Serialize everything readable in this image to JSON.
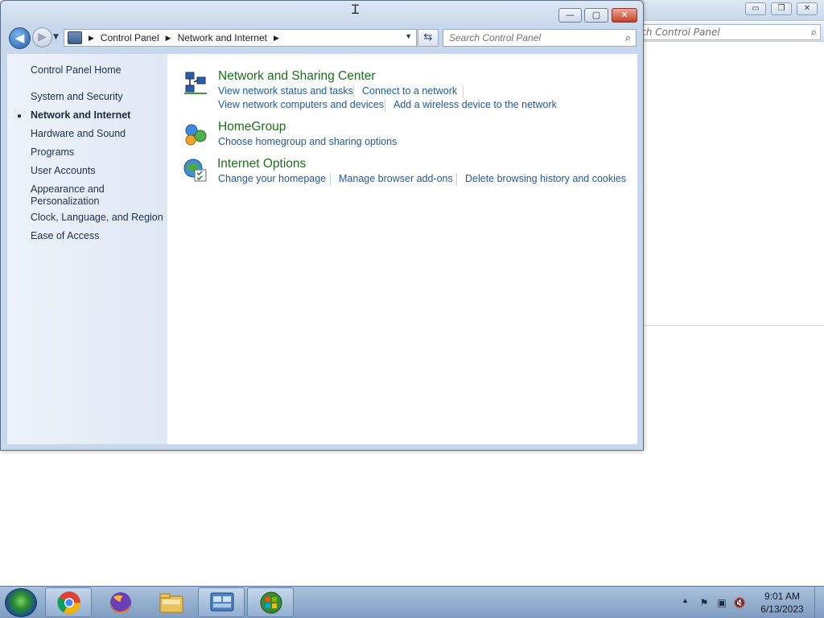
{
  "background_window": {
    "search_placeholder": "Search Control Panel",
    "controls": {
      "minimize": "▭",
      "restore": "❐",
      "close": "✕"
    }
  },
  "window": {
    "controls": {
      "minimize": "—",
      "maximize": "▢",
      "close": "✕"
    },
    "nav": {
      "back": "◀",
      "forward": "▶",
      "recent": "▼",
      "refresh": "⇆"
    },
    "address": {
      "crumbs": [
        "Control Panel",
        "Network and Internet"
      ],
      "separator": "▶",
      "dropdown": "▼"
    },
    "search": {
      "placeholder": "Search Control Panel",
      "icon": "search-icon"
    }
  },
  "sidebar": {
    "items": [
      {
        "label": "Control Panel Home"
      },
      {
        "label": "System and Security"
      },
      {
        "label": "Network and Internet",
        "current": true
      },
      {
        "label": "Hardware and Sound"
      },
      {
        "label": "Programs"
      },
      {
        "label": "User Accounts"
      },
      {
        "label": "Appearance and\nPersonalization"
      },
      {
        "label": "Clock, Language, and Region"
      },
      {
        "label": "Ease of Access"
      }
    ],
    "bullet": "●"
  },
  "categories": [
    {
      "title": "Network and Sharing Center",
      "icon": "network-sharing-icon",
      "links": [
        "View network status and tasks",
        "Connect to a network",
        "View network computers and devices",
        "Add a wireless device to the network"
      ]
    },
    {
      "title": "HomeGroup",
      "icon": "homegroup-icon",
      "links": [
        "Choose homegroup and sharing options"
      ]
    },
    {
      "title": "Internet Options",
      "icon": "internet-options-icon",
      "links": [
        "Change your homepage",
        "Manage browser add-ons",
        "Delete browsing history and cookies"
      ]
    }
  ],
  "taskbar": {
    "pinned": [
      "chrome-icon",
      "firefox-icon",
      "file-explorer-icon",
      "control-panel-icon",
      "windows-update-icon"
    ],
    "tray": {
      "arrow": "▲",
      "time": "9:01 AM",
      "date": "6/13/2023"
    }
  },
  "colors": {
    "link": "#1b5a9c",
    "category_title": "#1d6e1d",
    "sidebar_bg": "#e4ecf7"
  }
}
